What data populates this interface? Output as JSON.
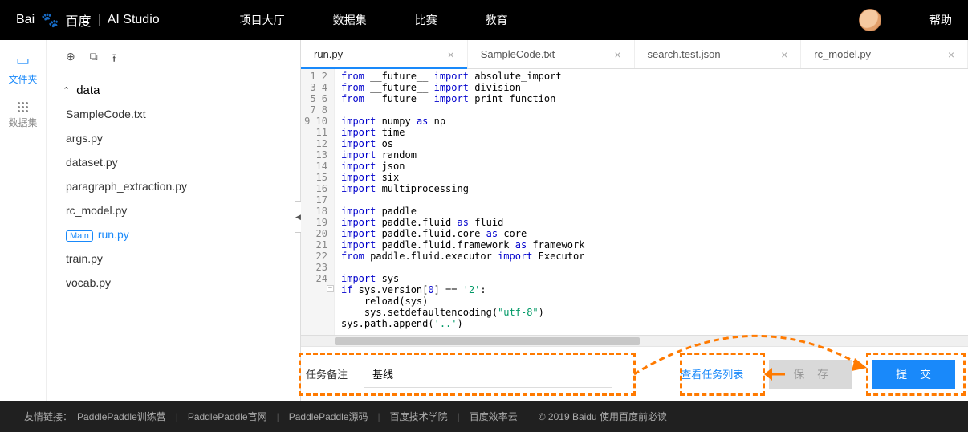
{
  "header": {
    "logo_baidu": "Bai",
    "logo_du": "百度",
    "logo_studio": "AI Studio",
    "nav": [
      "项目大厅",
      "数据集",
      "比赛",
      "教育"
    ],
    "help": "帮助"
  },
  "leftbar": {
    "files": "文件夹",
    "dataset": "数据集"
  },
  "sidebar": {
    "folder": "data",
    "files": [
      "SampleCode.txt",
      "args.py",
      "dataset.py",
      "paragraph_extraction.py",
      "rc_model.py"
    ],
    "main_badge": "Main",
    "active_file": "run.py",
    "files_after": [
      "train.py",
      "vocab.py"
    ]
  },
  "tabs": [
    {
      "label": "run.py",
      "active": true
    },
    {
      "label": "SampleCode.txt",
      "active": false
    },
    {
      "label": "search.test.json",
      "active": false
    },
    {
      "label": "rc_model.py",
      "active": false
    }
  ],
  "code_lines": 24,
  "task": {
    "label": "任务备注",
    "value": "基线",
    "view_list": "查看任务列表",
    "save": "保 存",
    "submit": "提 交"
  },
  "footer": {
    "label": "友情链接：",
    "links": [
      "PaddlePaddle训练营",
      "PaddlePaddle官网",
      "PaddlePaddle源码",
      "百度技术学院",
      "百度效率云"
    ],
    "copyright": "© 2019 Baidu 使用百度前必读"
  }
}
